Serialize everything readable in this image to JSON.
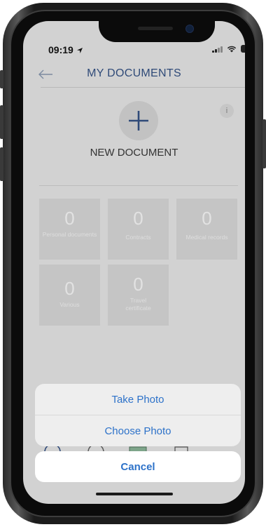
{
  "status_bar": {
    "time": "09:19",
    "battery": "97"
  },
  "header": {
    "title": "MY DOCUMENTS"
  },
  "new_document": {
    "label": "NEW DOCUMENT",
    "info": "i"
  },
  "categories": [
    {
      "count": "0",
      "label": "Personal documents"
    },
    {
      "count": "0",
      "label": "Contracts"
    },
    {
      "count": "0",
      "label": "Medical records"
    },
    {
      "count": "0",
      "label": "Various"
    },
    {
      "count": "0",
      "label": "Travel certificate"
    }
  ],
  "action_sheet": {
    "take_photo": "Take Photo",
    "choose_photo": "Choose Photo",
    "cancel": "Cancel"
  },
  "colors": {
    "accent": "#2d72c9",
    "title": "#2f4a78",
    "overlay_bg": "#d2d2d2"
  }
}
